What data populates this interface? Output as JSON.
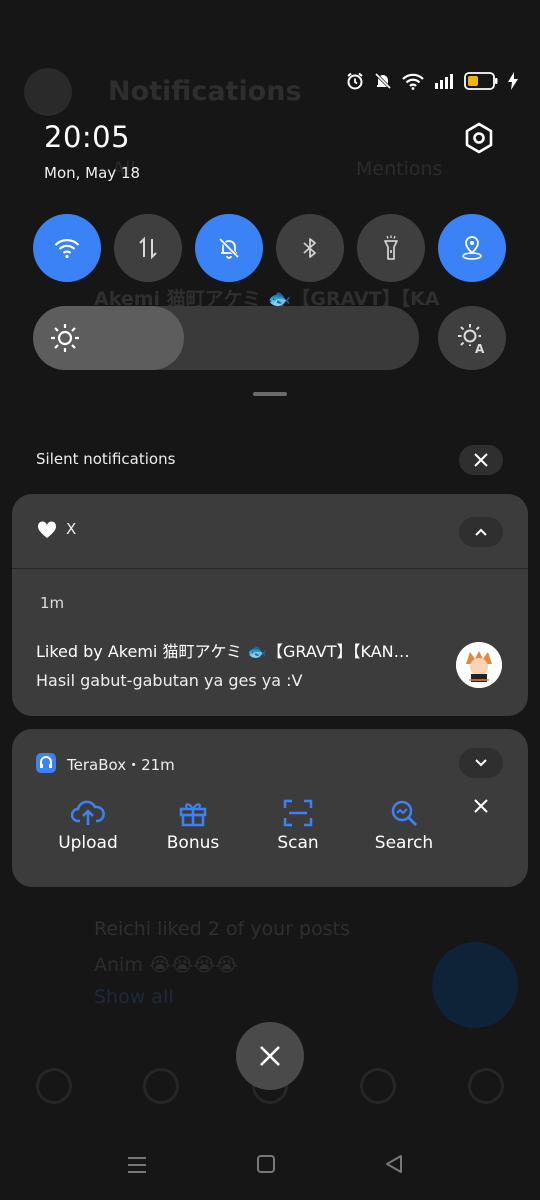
{
  "background": {
    "title": "Notifications",
    "tab_all": "All",
    "tab_mentions": "Mentions",
    "row_name": "Akemi 猫町アケミ 🐟【GRAVT】【KA",
    "reichi": "Reichi liked 2 of your posts",
    "anim": "Anim 😭😭😭😭",
    "show_all": "Show all"
  },
  "status_bar": {
    "icons": [
      "alarm-icon",
      "mute-icon",
      "wifi-icon",
      "signal-icon",
      "battery-icon",
      "charging-icon"
    ],
    "battery_color": "#f5b400"
  },
  "header": {
    "time": "20:05",
    "date": "Mon, May 18"
  },
  "quick_tiles": [
    {
      "name": "wifi",
      "on": true
    },
    {
      "name": "mobile-data",
      "on": false
    },
    {
      "name": "silent",
      "on": true
    },
    {
      "name": "bluetooth",
      "on": false
    },
    {
      "name": "flashlight",
      "on": false
    },
    {
      "name": "location",
      "on": true
    }
  ],
  "brightness": {
    "level": 0.39
  },
  "silent": {
    "label": "Silent notifications"
  },
  "notification_x": {
    "app": "X",
    "time": "1m",
    "title": "Liked by Akemi 猫町アケミ 🐟【GRAVT】【KAN…",
    "text": "Hasil gabut-gabutan ya ges ya :V"
  },
  "notification_terabox": {
    "app": "TeraBox・21m",
    "actions": [
      {
        "label": "Upload"
      },
      {
        "label": "Bonus"
      },
      {
        "label": "Scan"
      },
      {
        "label": "Search"
      }
    ]
  },
  "accent": "#3b82f6"
}
